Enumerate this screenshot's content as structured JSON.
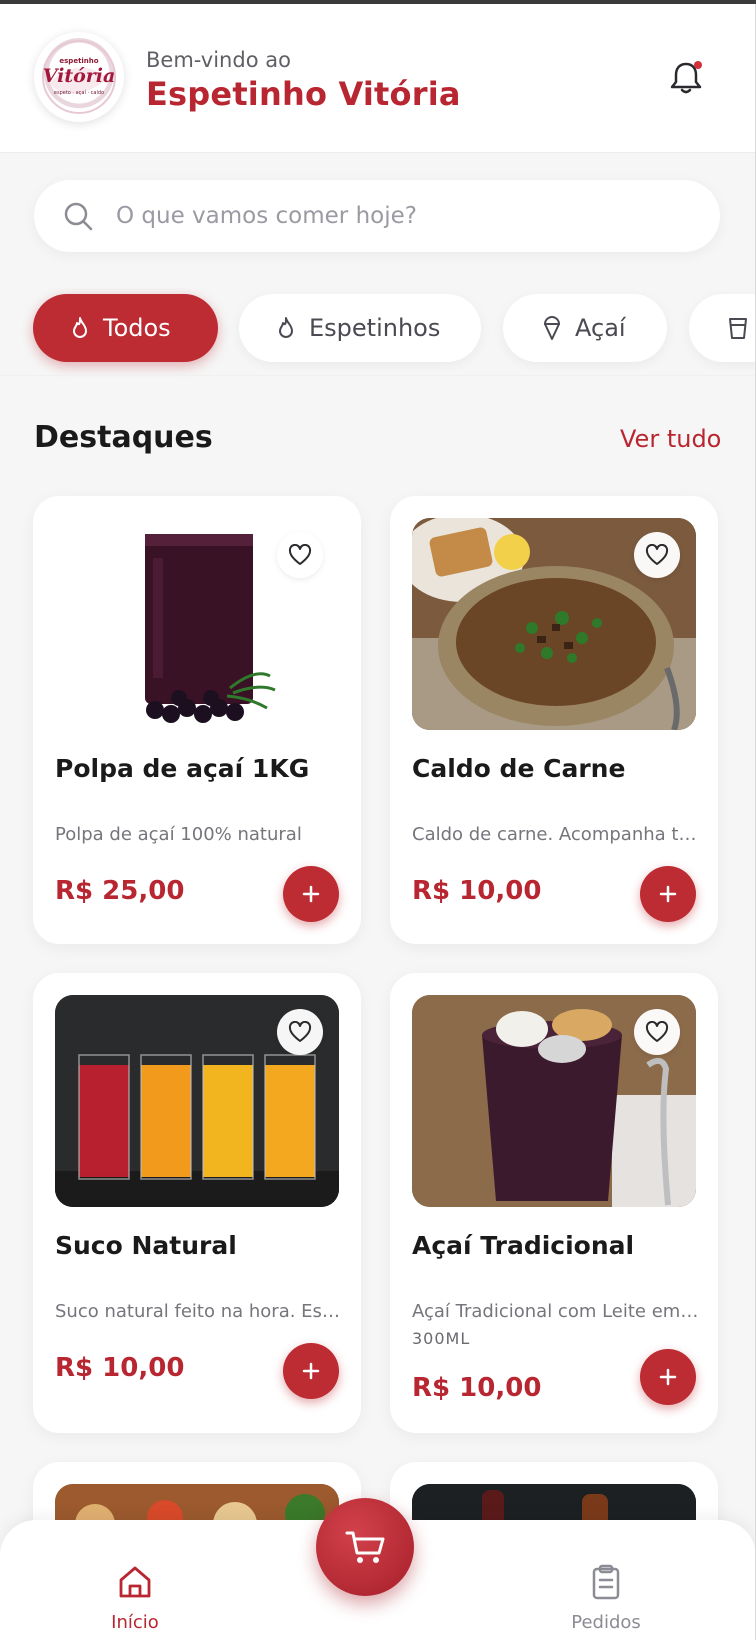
{
  "header": {
    "welcome": "Bem-vindo ao",
    "brand": "Espetinho Vitória",
    "logo_text": "espetinho Vitória espeto · açaí · caldo",
    "bell_icon": "bell-icon"
  },
  "search": {
    "placeholder": "O que vamos comer hoje?"
  },
  "categories": [
    {
      "label": "Todos",
      "icon": "flame-icon",
      "active": true
    },
    {
      "label": "Espetinhos",
      "icon": "flame-icon",
      "active": false
    },
    {
      "label": "Açaí",
      "icon": "icecream-icon",
      "active": false
    },
    {
      "label": "",
      "icon": "cup-icon",
      "active": false
    }
  ],
  "section": {
    "title": "Destaques",
    "see_all": "Ver tudo"
  },
  "products": [
    {
      "name": "Polpa de açaí 1KG",
      "description": "Polpa de açaí 100% natural",
      "size": "",
      "price": "R$ 25,00",
      "image": "acai-pulp-pack"
    },
    {
      "name": "Caldo de Carne",
      "description": "Caldo de carne. Acompanha torradas",
      "size": "",
      "price": "R$ 10,00",
      "image": "beef-broth-bowl"
    },
    {
      "name": "Suco Natural",
      "description": "Suco natural feito na hora. Escolha o sabor",
      "size": "",
      "price": "R$ 10,00",
      "image": "juice-glasses"
    },
    {
      "name": "Açaí Tradicional",
      "description": "Açaí Tradicional com Leite em pó e paçoca",
      "size": "300ML",
      "price": "R$ 10,00",
      "image": "acai-cup"
    }
  ],
  "nav": {
    "home_label": "Início",
    "orders_label": "Pedidos"
  },
  "colors": {
    "primary": "#bd2b33",
    "text": "#1a1a1a",
    "muted": "#75757c",
    "background": "#f6f6f6"
  }
}
